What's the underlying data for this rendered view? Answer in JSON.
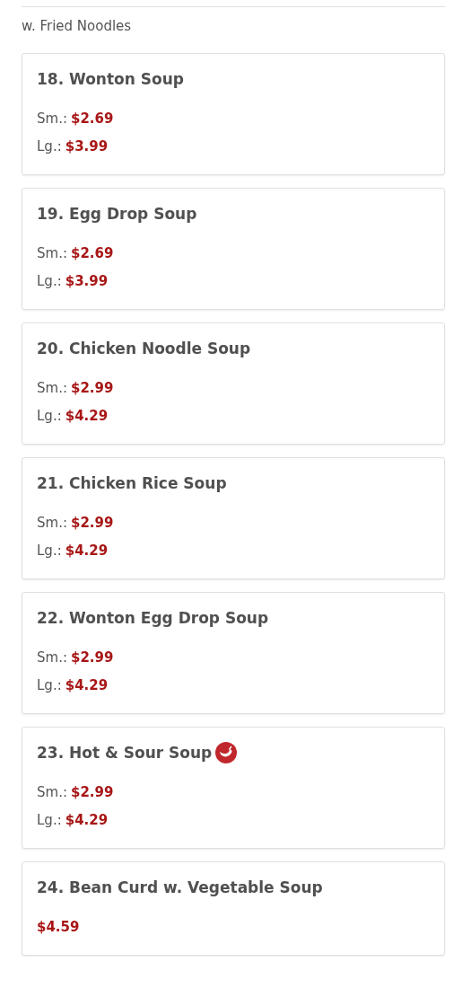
{
  "section_note": "w. Fried Noodles",
  "items": [
    {
      "title": "18. Wonton Soup",
      "spicy": false,
      "prices": [
        {
          "label": "Sm.:",
          "value": "$2.69"
        },
        {
          "label": "Lg.:",
          "value": "$3.99"
        }
      ]
    },
    {
      "title": "19. Egg Drop Soup",
      "spicy": false,
      "prices": [
        {
          "label": "Sm.:",
          "value": "$2.69"
        },
        {
          "label": "Lg.:",
          "value": "$3.99"
        }
      ]
    },
    {
      "title": "20. Chicken Noodle Soup",
      "spicy": false,
      "prices": [
        {
          "label": "Sm.:",
          "value": "$2.99"
        },
        {
          "label": "Lg.:",
          "value": "$4.29"
        }
      ]
    },
    {
      "title": "21. Chicken Rice Soup",
      "spicy": false,
      "prices": [
        {
          "label": "Sm.:",
          "value": "$2.99"
        },
        {
          "label": "Lg.:",
          "value": "$4.29"
        }
      ]
    },
    {
      "title": "22. Wonton Egg Drop Soup",
      "spicy": false,
      "prices": [
        {
          "label": "Sm.:",
          "value": "$2.99"
        },
        {
          "label": "Lg.:",
          "value": "$4.29"
        }
      ]
    },
    {
      "title": "23. Hot & Sour Soup",
      "spicy": true,
      "prices": [
        {
          "label": "Sm.:",
          "value": "$2.99"
        },
        {
          "label": "Lg.:",
          "value": "$4.29"
        }
      ]
    },
    {
      "title": "24. Bean Curd w. Vegetable Soup",
      "spicy": false,
      "prices": [
        {
          "value": "$4.59"
        }
      ]
    }
  ]
}
